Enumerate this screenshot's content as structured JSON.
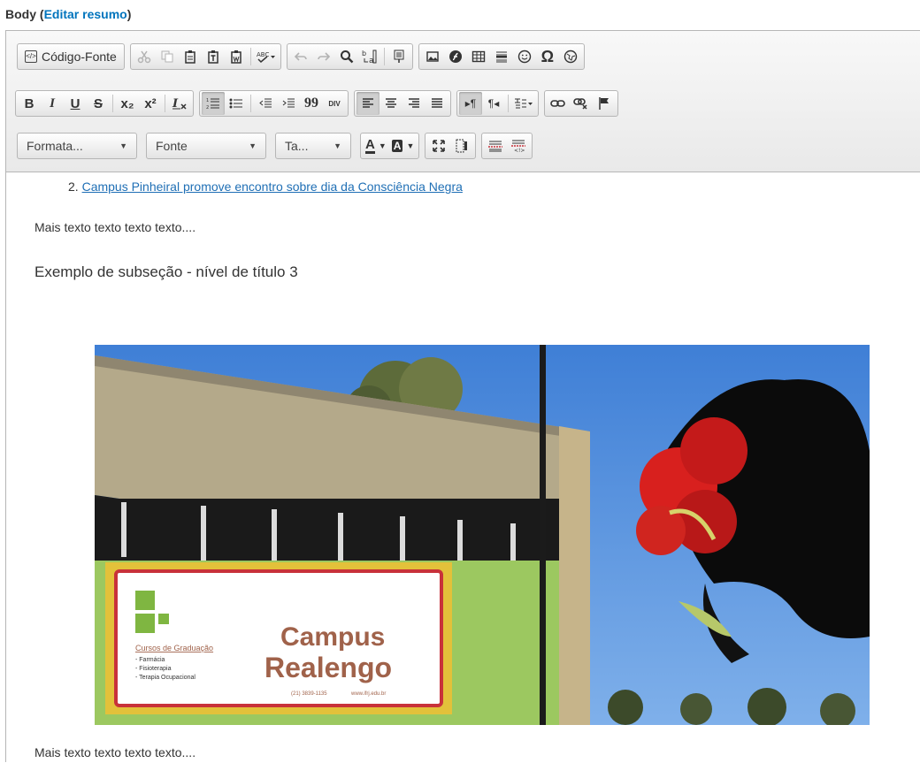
{
  "field": {
    "label": "Body",
    "paren_open": "(",
    "edit_summary": "Editar resumo",
    "paren_close": ")"
  },
  "toolbar": {
    "source_label": "Código-Fonte",
    "format_label": "Formata...",
    "font_label": "Fonte",
    "size_label": "Ta...",
    "bold": "B",
    "italic": "I",
    "underline": "U",
    "strike": "S",
    "subscript": "x₂",
    "superscript": "x²",
    "blockquote": "99",
    "div": "DIV",
    "omega": "Ω",
    "text_color": "A",
    "bg_color": "A"
  },
  "content": {
    "list_number": "2.",
    "list_link": "Campus Pinheiral promove encontro sobre dia da Consciência Negra",
    "para1": "Mais texto texto texto texto....",
    "heading3": "Exemplo de subseção - nível de título 3",
    "para2": "Mais texto texto texto texto...."
  },
  "photo": {
    "sign_title": "Campus",
    "sign_title2": "Realengo",
    "sign_courses_heading": "Cursos de Graduação",
    "sign_course1": "- Farmácia",
    "sign_course2": "- Fisioterapia",
    "sign_course3": "- Terapia Ocupacional",
    "sign_phone": "(21) 3839-1135",
    "sign_web": "www.ifrj.edu.br"
  },
  "colors": {
    "link": "#1f6fb5",
    "accent_link": "#0074bd",
    "sky": "#5b8ed8",
    "sign_red": "#c8323a",
    "wall_green": "#9cc860"
  }
}
